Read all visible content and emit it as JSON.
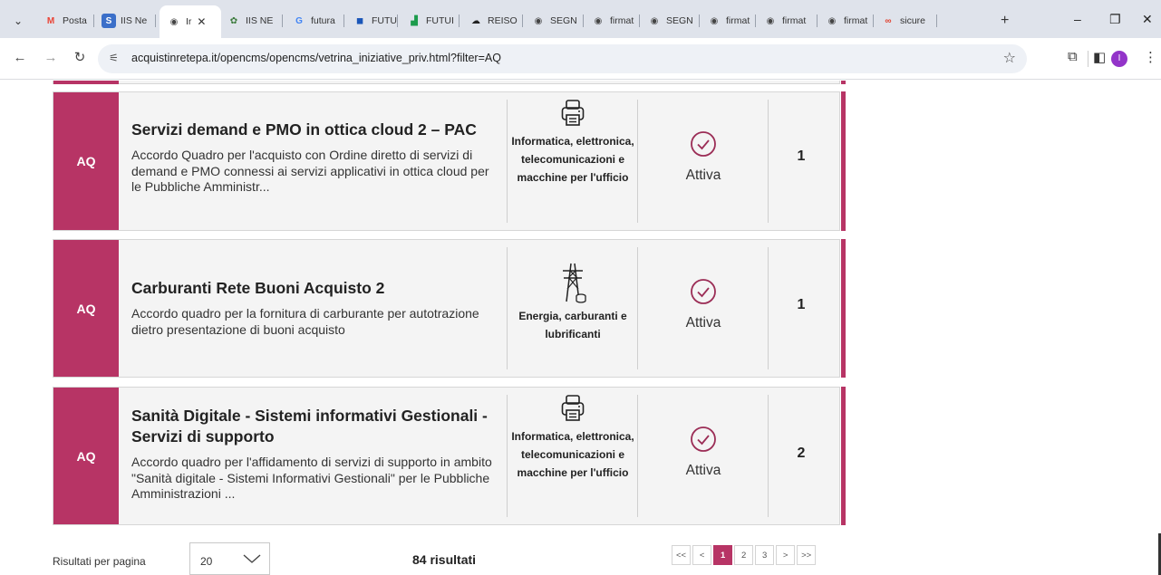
{
  "browser": {
    "tabs": [
      {
        "label": "Posta",
        "fav": "M",
        "fav_color": "#ea4335",
        "fav_bg": "transparent"
      },
      {
        "label": "IIS Ne",
        "fav": "S",
        "fav_color": "#ffffff",
        "fav_bg": "#3b6fc9"
      },
      {
        "label": "Ir",
        "fav": "◉",
        "fav_color": "#444",
        "fav_bg": "transparent",
        "active": true
      },
      {
        "label": "IIS NE",
        "fav": "✿",
        "fav_color": "#3a7a3a",
        "fav_bg": "transparent"
      },
      {
        "label": "futura",
        "fav": "G",
        "fav_color": "#4285f4",
        "fav_bg": "transparent"
      },
      {
        "label": "FUTUI",
        "fav": "◼",
        "fav_color": "#1a56b8",
        "fav_bg": "transparent"
      },
      {
        "label": "FUTUI",
        "fav": "▟",
        "fav_color": "#1c9b4c",
        "fav_bg": "transparent"
      },
      {
        "label": "REISO",
        "fav": "☁",
        "fav_color": "#222",
        "fav_bg": "transparent"
      },
      {
        "label": "SEGN",
        "fav": "◉",
        "fav_color": "#444",
        "fav_bg": "transparent"
      },
      {
        "label": "firmat",
        "fav": "◉",
        "fav_color": "#444",
        "fav_bg": "transparent"
      },
      {
        "label": "SEGN",
        "fav": "◉",
        "fav_color": "#444",
        "fav_bg": "transparent"
      },
      {
        "label": "firmat",
        "fav": "◉",
        "fav_color": "#444",
        "fav_bg": "transparent"
      },
      {
        "label": "firmat",
        "fav": "◉",
        "fav_color": "#444",
        "fav_bg": "transparent"
      },
      {
        "label": "firmat",
        "fav": "◉",
        "fav_color": "#444",
        "fav_bg": "transparent"
      },
      {
        "label": "sicure",
        "fav": "∞",
        "fav_color": "#e0412e",
        "fav_bg": "transparent"
      }
    ],
    "tab_menu_icon": "chevron-down-icon",
    "close_tab_glyph": "✕",
    "new_tab_glyph": "+",
    "window_controls": {
      "minimize": "–",
      "restore": "❐",
      "close": "✕"
    },
    "address": {
      "url": "acquistinretepa.it/opencms/opencms/vetrina_iniziative_priv.html?filter=AQ",
      "site_info_icon": "tune-icon"
    },
    "profile_initial": "I"
  },
  "cards": [
    {
      "badge": "AQ",
      "title": "Servizi demand e PMO in ottica cloud 2 – PAC",
      "description": "Accordo Quadro per l'acquisto con Ordine diretto di servizi di demand e PMO connessi ai servizi applicativi in ottica cloud per le Pubbliche Amministr...",
      "category_icon": "printer-icon",
      "category": "Informatica, elettronica, telecomunicazioni e macchine per l'ufficio",
      "status_icon": "check-circle-icon",
      "status": "Attiva",
      "count": "1"
    },
    {
      "badge": "AQ",
      "title": "Carburanti Rete Buoni Acquisto 2",
      "description": "Accordo quadro per la fornitura di carburante per autotrazione dietro presentazione di buoni acquisto",
      "category_icon": "power-pylon-icon",
      "category": "Energia, carburanti e lubrificanti",
      "status_icon": "check-circle-icon",
      "status": "Attiva",
      "count": "1"
    },
    {
      "badge": "AQ",
      "title": "Sanità Digitale - Sistemi informativi Gestionali - Servizi di supporto",
      "description": "Accordo quadro per l'affidamento di servizi di supporto in ambito \"Sanità digitale - Sistemi Informativi Gestionali\" per le Pubbliche Amministrazioni ...",
      "category_icon": "printer-icon",
      "category": "Informatica, elettronica, telecomunicazioni e macchine per l'ufficio",
      "status_icon": "check-circle-icon",
      "status": "Attiva",
      "count": "2"
    }
  ],
  "footer": {
    "rpp_label": "Risultati per pagina",
    "rpp_value": "20",
    "results": "84 risultati",
    "pager": [
      "<<",
      "<",
      "1",
      "2",
      "3",
      ">",
      ">>"
    ],
    "current_page": "1"
  },
  "colors": {
    "accent": "#b73465"
  }
}
